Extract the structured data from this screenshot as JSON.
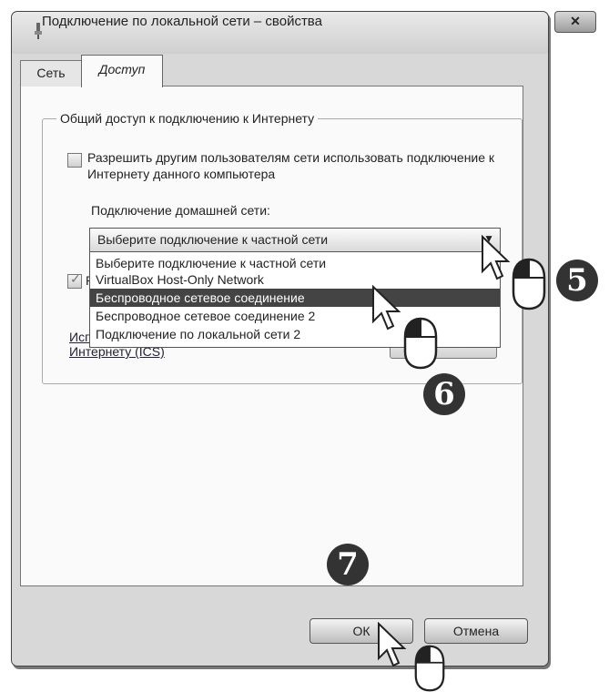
{
  "window": {
    "title": "Подключение по локальной сети – свойства",
    "close_label": "✕"
  },
  "tabs": [
    {
      "label": "Сеть",
      "active": false
    },
    {
      "label": "Доступ",
      "active": true
    }
  ],
  "sharing": {
    "group_title": "Общий доступ к подключению к Интернету",
    "allow_checkbox": {
      "checked": false,
      "label": "Разрешить другим пользователям сети использовать подключение к Интернету данного компьютера"
    },
    "home_network_label": "Подключение домашней сети:",
    "select": {
      "value": "Выберите подключение к частной сети",
      "options": [
        "Выберите подключение к частной сети",
        "VirtualBox Host-Only Network",
        "Беспроводное сетевое соединение",
        "Беспроводное сетевое соединение 2",
        "Подключение по локальной сети 2"
      ],
      "highlighted_index": 2
    },
    "second_checkbox": {
      "checked": true,
      "label_visible": "Р"
    },
    "link_fragment_1": "Исп",
    "link_fragment_2": "Интернету (ICS)"
  },
  "buttons": {
    "ok": "ОК",
    "cancel": "Отмена"
  },
  "callouts": [
    "5",
    "6",
    "7"
  ]
}
